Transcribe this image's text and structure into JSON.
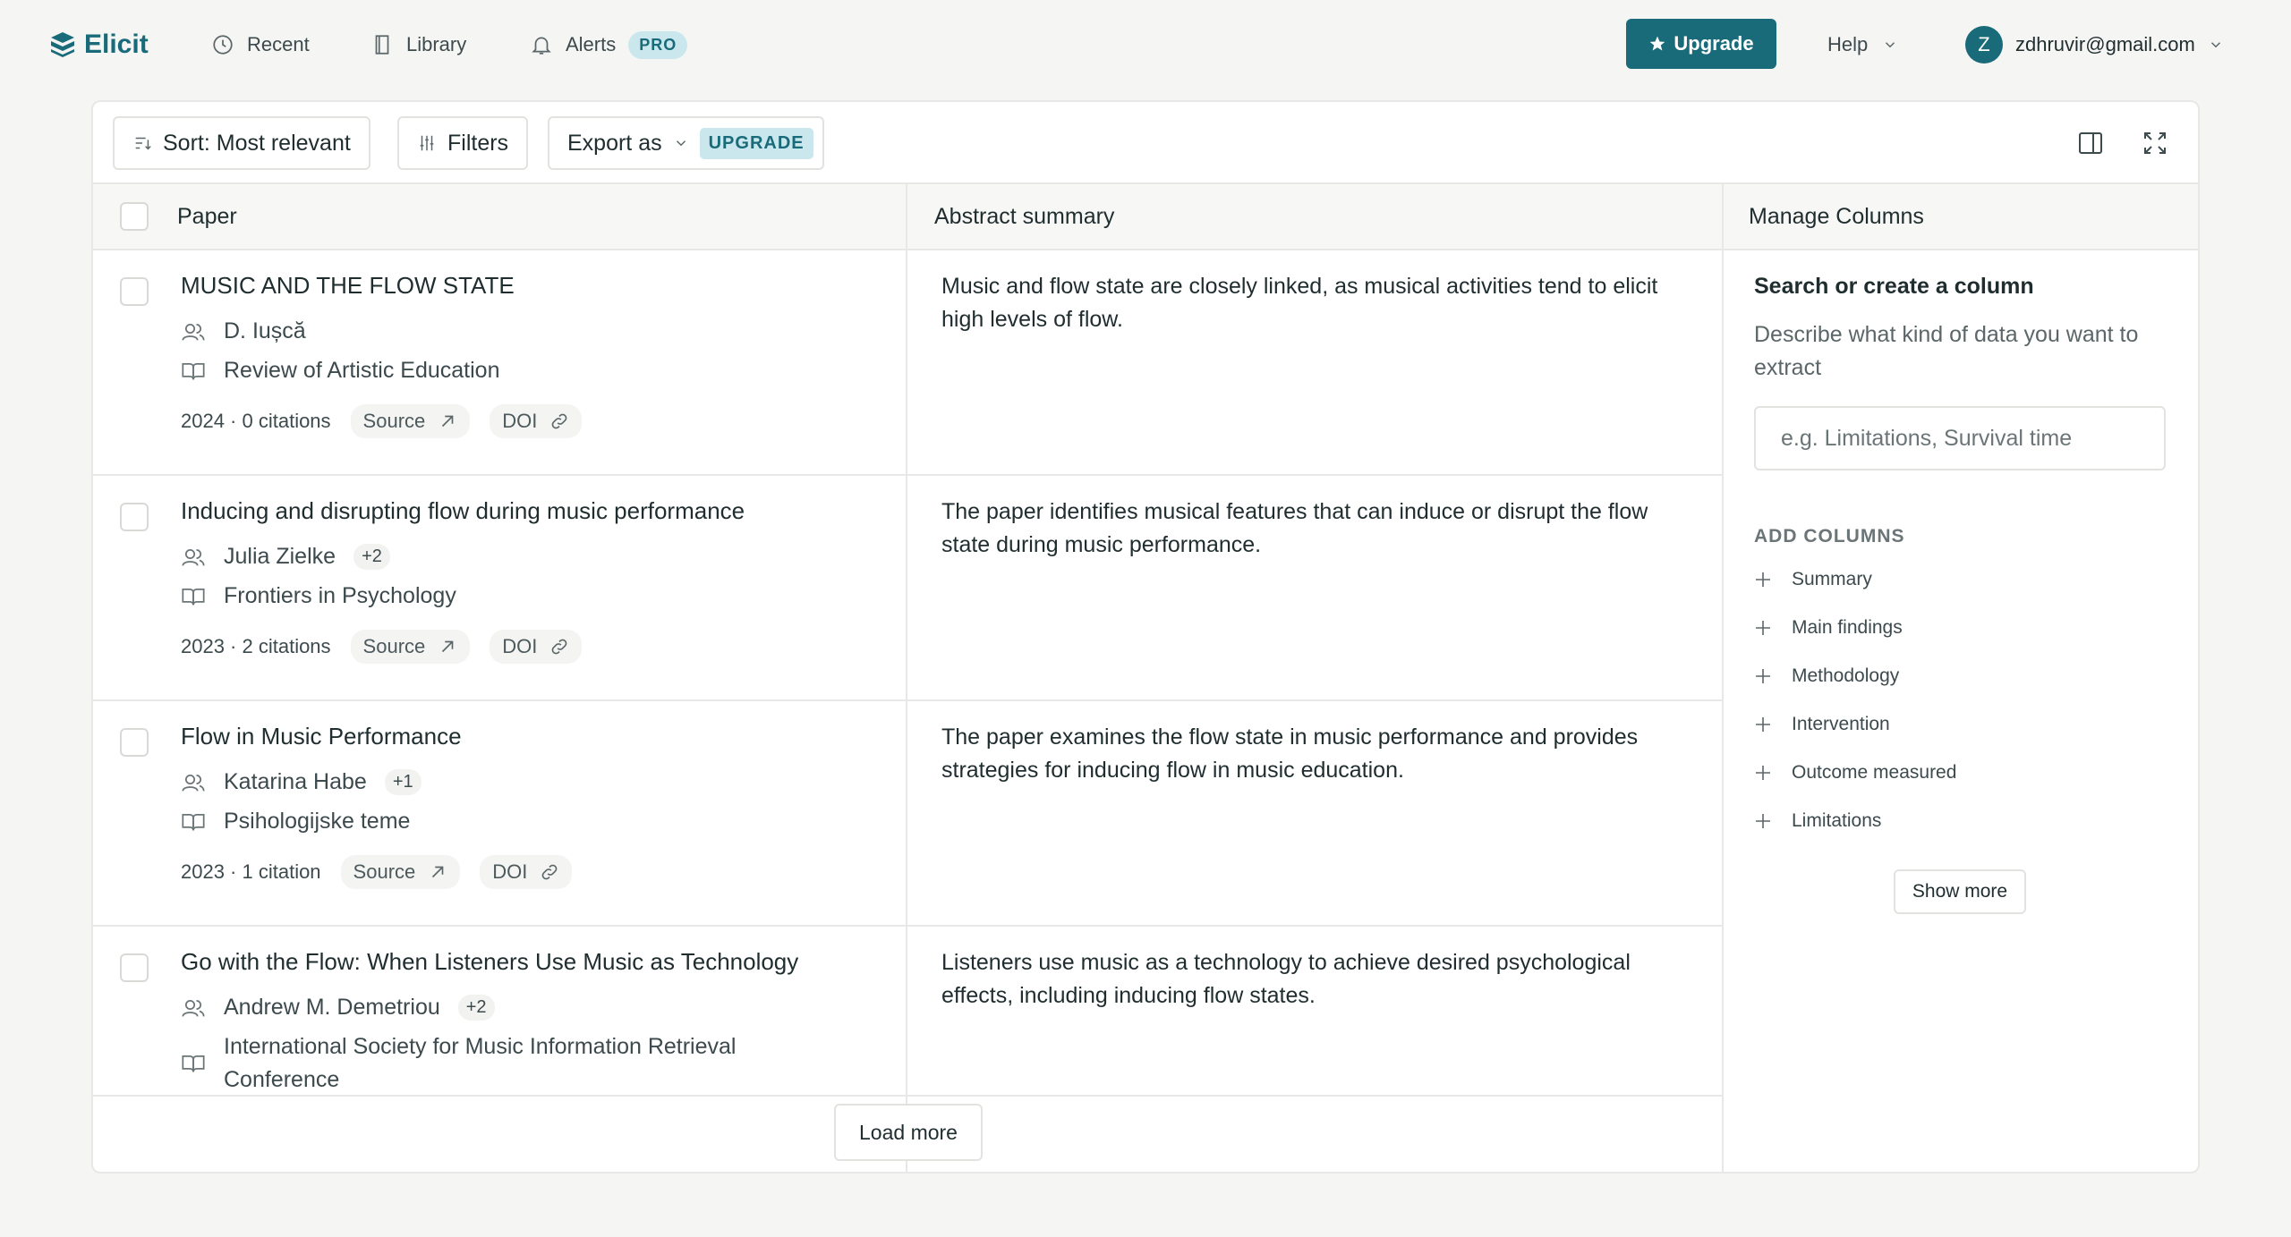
{
  "nav": {
    "logo": "Elicit",
    "recent": "Recent",
    "library": "Library",
    "alerts": "Alerts",
    "pro_badge": "PRO",
    "upgrade": "Upgrade",
    "help": "Help",
    "avatar_initial": "Z",
    "user_email": "zdhruvir@gmail.com"
  },
  "toolbar": {
    "sort": "Sort: Most relevant",
    "filters": "Filters",
    "export": "Export as",
    "upgrade_tag": "UPGRADE"
  },
  "table": {
    "col_paper": "Paper",
    "col_abstract": "Abstract summary",
    "col_manage": "Manage Columns",
    "rows": [
      {
        "title": "MUSIC AND THE FLOW STATE",
        "author": "D. Iușcă",
        "extra_authors": "",
        "venue": "Review of Artistic Education",
        "stats": "2024 · 0 citations",
        "source": "Source",
        "doi": "DOI",
        "abstract": "Music and flow state are closely linked, as musical activities tend to elicit high levels of flow."
      },
      {
        "title": "Inducing and disrupting flow during music performance",
        "author": "Julia Zielke",
        "extra_authors": "+2",
        "venue": "Frontiers in Psychology",
        "stats": "2023 · 2 citations",
        "source": "Source",
        "doi": "DOI",
        "abstract": "The paper identifies musical features that can induce or disrupt the flow state during music performance."
      },
      {
        "title": "Flow in Music Performance",
        "author": "Katarina Habe",
        "extra_authors": "+1",
        "venue": "Psihologijske teme",
        "stats": "2023 · 1 citation",
        "source": "Source",
        "doi": "DOI",
        "abstract": "The paper examines the flow state in music performance and provides strategies for inducing flow in music education."
      },
      {
        "title": "Go with the Flow: When Listeners Use Music as Technology",
        "author": "Andrew M. Demetriou",
        "extra_authors": "+2",
        "venue": "International Society for Music Information Retrieval Conference",
        "stats": "",
        "source": "",
        "doi": "",
        "abstract": "Listeners use music as a technology to achieve desired psychological effects, including inducing flow states."
      }
    ],
    "load_more": "Load more"
  },
  "manage": {
    "search_title": "Search or create a column",
    "description": "Describe what kind of data you want to extract",
    "placeholder": "e.g. Limitations, Survival time",
    "add_columns_label": "ADD COLUMNS",
    "items": [
      "Summary",
      "Main findings",
      "Methodology",
      "Intervention",
      "Outcome measured",
      "Limitations"
    ],
    "show_more": "Show more"
  }
}
